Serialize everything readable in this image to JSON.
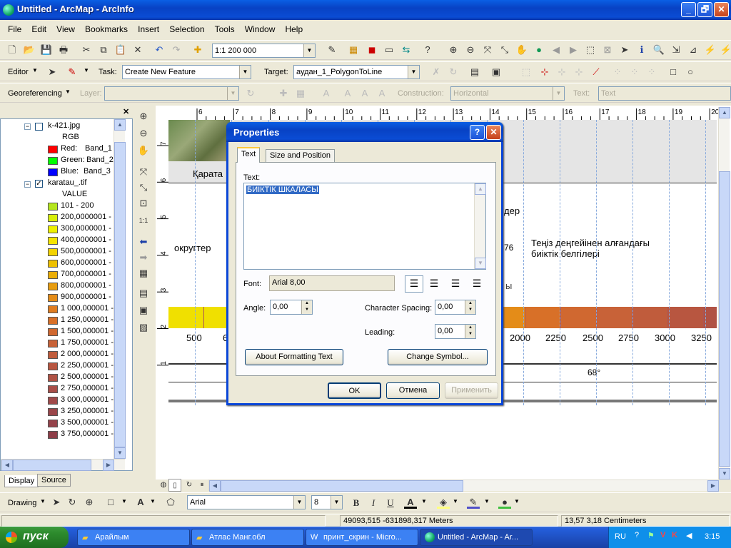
{
  "window": {
    "title": "Untitled - ArcMap - ArcInfo",
    "minimize": "_",
    "restore": "🗗",
    "close": "✕"
  },
  "menu": [
    "File",
    "Edit",
    "View",
    "Bookmarks",
    "Insert",
    "Selection",
    "Tools",
    "Window",
    "Help"
  ],
  "standard_toolbar": {
    "scale": "1:1 200 000"
  },
  "editor_toolbar": {
    "editor_label": "Editor",
    "task_label": "Task:",
    "task_value": "Create New Feature",
    "target_label": "Target:",
    "target_value": "аудан_1_PolygonToLine"
  },
  "georef_toolbar": {
    "georef_label": "Georeferencing",
    "layer_label": "Layer:",
    "construction_label": "Construction:",
    "construction_value": "Horizontal",
    "text_label": "Text:",
    "text_value": "Text"
  },
  "toc": {
    "layers": [
      {
        "name": "k-421.jpg",
        "checked": false,
        "items": [
          {
            "label": "RGB"
          },
          {
            "label": "Red:",
            "value": "Band_1",
            "color": "#ff0000"
          },
          {
            "label": "Green:",
            "value": "Band_2",
            "color": "#00ff00"
          },
          {
            "label": "Blue:",
            "value": "Band_3",
            "color": "#0000ff"
          }
        ]
      },
      {
        "name": "karatau_.tif",
        "checked": true,
        "field": "VALUE",
        "classes": [
          {
            "label": "101 - 200",
            "color": "#b5e61d"
          },
          {
            "label": "200,0000001 -",
            "color": "#d7ee0b"
          },
          {
            "label": "300,0000001 -",
            "color": "#eef000"
          },
          {
            "label": "400,0000001 -",
            "color": "#f5e400"
          },
          {
            "label": "500,0000001 -",
            "color": "#f3d300"
          },
          {
            "label": "600,0000001 -",
            "color": "#efc100"
          },
          {
            "label": "700,0000001 -",
            "color": "#ebae07"
          },
          {
            "label": "800,0000001 -",
            "color": "#e89d10"
          },
          {
            "label": "900,0000001 -",
            "color": "#e48c18"
          },
          {
            "label": "1 000,000001 -",
            "color": "#df7c20"
          },
          {
            "label": "1 250,000001 -",
            "color": "#d87028"
          },
          {
            "label": "1 500,000001 -",
            "color": "#d06830"
          },
          {
            "label": "1 750,000001 -",
            "color": "#c86238"
          },
          {
            "label": "2 000,000001 -",
            "color": "#c05c3c"
          },
          {
            "label": "2 250,000001 -",
            "color": "#b85640"
          },
          {
            "label": "2 500,000001 -",
            "color": "#b05244"
          },
          {
            "label": "2 750,000001 -",
            "color": "#a84e48"
          },
          {
            "label": "3 000,000001 -",
            "color": "#a04a4a"
          },
          {
            "label": "3 250,000001 -",
            "color": "#9a464a"
          },
          {
            "label": "3 500,000001 -",
            "color": "#94424a"
          },
          {
            "label": "3 750,000001 -",
            "color": "#8e3e48"
          }
        ]
      }
    ],
    "tabs": [
      "Display",
      "Source"
    ]
  },
  "ruler": {
    "h": [
      "6",
      "7",
      "8",
      "9",
      "10",
      "11",
      "12",
      "13",
      "14",
      "15",
      "16",
      "17",
      "18",
      "19",
      "20"
    ],
    "v": [
      "7",
      "6",
      "5",
      "4",
      "3",
      "2",
      "1"
    ]
  },
  "map": {
    "text1": "Қарата",
    "text2": "дер",
    "text3": "округтер",
    "text4": "76",
    "text5": "Теңіз деңгейінен алғандағы",
    "text6": "биіктік белгілері",
    "text7": "ы",
    "scale_labels": [
      "500",
      "6",
      "2000",
      "2250",
      "2500",
      "2750",
      "3000",
      "3250"
    ],
    "degree": "68°"
  },
  "dialog": {
    "title": "Properties",
    "help": "?",
    "close": "✕",
    "tabs": [
      "Text",
      "Size and Position"
    ],
    "text_label": "Text:",
    "text_value": "БИІКТІК ШКАЛАСЫ",
    "font_label": "Font:",
    "font_value": "Arial 8,00",
    "angle_label": "Angle:",
    "angle_value": "0,00",
    "char_spacing_label": "Character Spacing:",
    "char_spacing_value": "0,00",
    "leading_label": "Leading:",
    "leading_value": "0,00",
    "about_btn": "About Formatting Text",
    "change_symbol_btn": "Change Symbol...",
    "ok_btn": "OK",
    "cancel_btn": "Отмена",
    "apply_btn": "Применить"
  },
  "drawing_toolbar": {
    "drawing_label": "Drawing",
    "font": "Arial",
    "size": "8",
    "bold": "B",
    "italic": "I",
    "underline": "U"
  },
  "status": {
    "coords_map": "49093,515  -631898,317 Meters",
    "coords_page": "13,57  3,18 Centimeters"
  },
  "taskbar": {
    "start": "пуск",
    "tasks": [
      "Арайлым",
      "Атлас Манг.обл",
      "принт_скрин - Micro...",
      "Untitled - ArcMap - Ar..."
    ],
    "lang": "RU",
    "time": "3:15"
  }
}
